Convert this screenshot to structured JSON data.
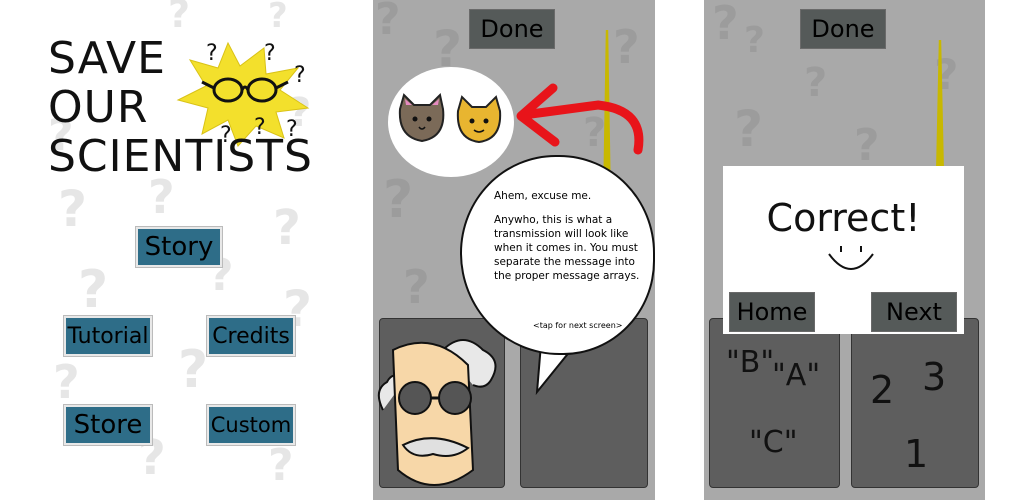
{
  "menu": {
    "title_lines": [
      "SAVE",
      "OUR",
      "SCIENTISTS"
    ],
    "buttons": {
      "story": "Story",
      "tutorial": "Tutorial",
      "credits": "Credits",
      "store": "Store",
      "custom": "Custom"
    }
  },
  "tutorial": {
    "done_label": "Done",
    "speech_lines": [
      "Ahem, excuse me.",
      "Anywho, this is what a transmission will look like when it comes in. You must separate the message into the proper message arrays."
    ],
    "tap_hint": "<tap for next screen>"
  },
  "result": {
    "done_label": "Done",
    "message": "Correct!",
    "home_label": "Home",
    "next_label": "Next",
    "left_slot_items": [
      "\"B\"",
      "\"A\"",
      "\"C\""
    ],
    "right_slot_items": [
      "2",
      "3",
      "1"
    ]
  },
  "colors": {
    "menu_button": "#2e6d88",
    "game_background": "#a9a9a9",
    "pointer_arrow": "#e8141a",
    "star_burst": "#f3e02c"
  }
}
